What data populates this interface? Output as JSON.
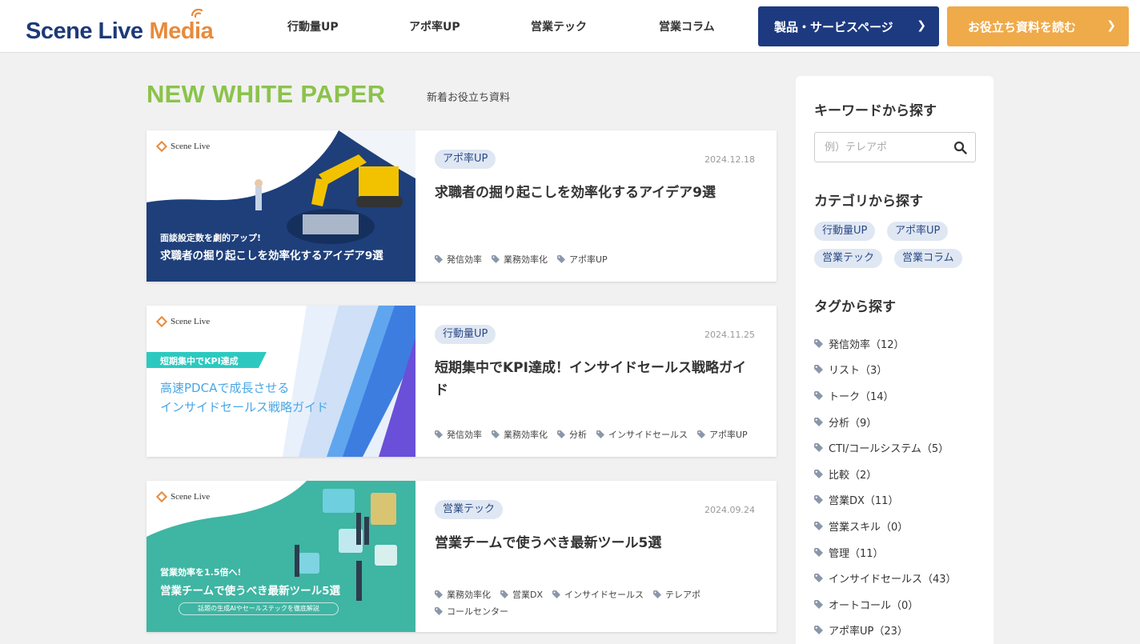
{
  "header": {
    "logo_word1": "Scene Live",
    "logo_word2": "Media",
    "nav": [
      "行動量UP",
      "アポ率UP",
      "営業テック",
      "営業コラム"
    ],
    "btn_products": "製品・サービスページ",
    "btn_resources": "お役立ち資料を読む"
  },
  "section": {
    "title": "NEW WHITE PAPER",
    "subtitle": "新着お役立ち資料"
  },
  "cards": [
    {
      "category": "アポ率UP",
      "date": "2024.12.18",
      "title": "求職者の掘り起こしを効率化するアイデア9選",
      "tags": [
        "発信効率",
        "業務効率化",
        "アポ率UP"
      ],
      "thumb": {
        "brand": "Scene Live",
        "line1": "面談設定数を劇的アップ!",
        "line2": "求職者の掘り起こしを効率化するアイデア9選"
      }
    },
    {
      "category": "行動量UP",
      "date": "2024.11.25",
      "title": "短期集中でKPI達成！インサイドセールス戦略ガイド",
      "tags": [
        "発信効率",
        "業務効率化",
        "分析",
        "インサイドセールス",
        "アポ率UP"
      ],
      "thumb": {
        "brand": "Scene Live",
        "ribbon": "短期集中でKPI達成",
        "line1": "高速PDCAで成長させる",
        "line2": "インサイドセールス戦略ガイド"
      }
    },
    {
      "category": "営業テック",
      "date": "2024.09.24",
      "title": "営業チームで使うべき最新ツール5選",
      "tags": [
        "業務効率化",
        "営業DX",
        "インサイドセールス",
        "テレアポ",
        "コールセンター"
      ],
      "thumb": {
        "brand": "Scene Live",
        "line1": "営業効率を1.5倍へ!",
        "line2": "営業チームで使うべき最新ツール5選",
        "line3": "話題の生成AIやセールステックを徹底解説"
      }
    }
  ],
  "sidebar": {
    "keyword_heading": "キーワードから探す",
    "search_placeholder": "例）テレアポ",
    "category_heading": "カテゴリから探す",
    "categories": [
      "行動量UP",
      "アポ率UP",
      "営業テック",
      "営業コラム"
    ],
    "tag_heading": "タグから探す",
    "tags": [
      "発信効率（12）",
      "リスト（3）",
      "トーク（14）",
      "分析（9）",
      "CTI/コールシステム（5）",
      "比較（2）",
      "営業DX（11）",
      "営業スキル（0）",
      "管理（11）",
      "インサイドセールス（43）",
      "オートコール（0）",
      "アポ率UP（23）"
    ]
  },
  "colors": {
    "brand_navy": "#1d3a80",
    "brand_orange": "#efaa4a",
    "accent_green": "#8bc34a",
    "chip_bg": "#dfe7f3"
  }
}
